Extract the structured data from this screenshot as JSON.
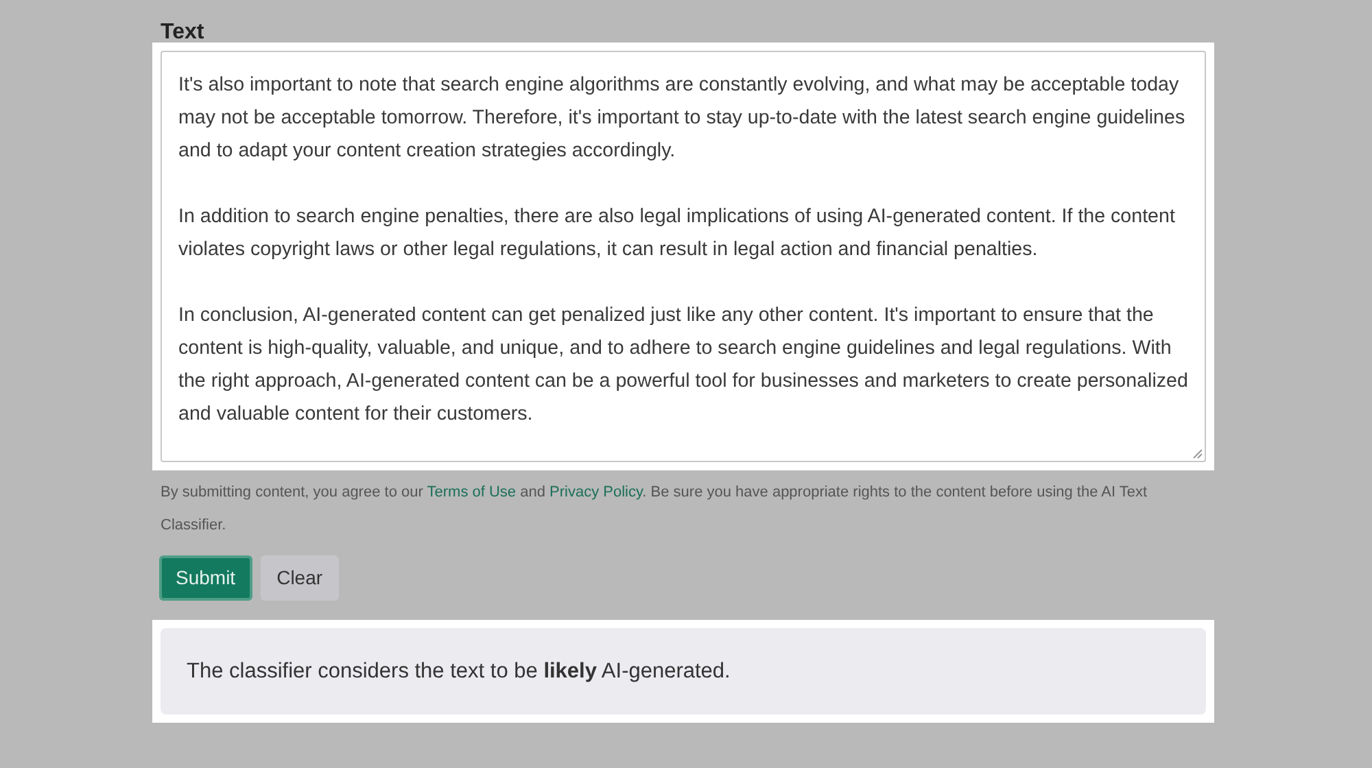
{
  "field_label": "Text",
  "text_input": {
    "paragraphs": [
      "It's also important to note that search engine algorithms are constantly evolving, and what may be acceptable today may not be acceptable tomorrow. Therefore, it's important to stay up-to-date with the latest search engine guidelines and to adapt your content creation strategies accordingly.",
      "In addition to search engine penalties, there are also legal implications of using AI-generated content. If the content violates copyright laws or other legal regulations, it can result in legal action and financial penalties.",
      "In conclusion, AI-generated content can get penalized just like any other content. It's important to ensure that the content is high-quality, valuable, and unique, and to adhere to search engine guidelines and legal regulations. With the right approach, AI-generated content can be a powerful tool for businesses and marketers to create personalized and valuable content for their customers."
    ]
  },
  "disclaimer": [
    {
      "kind": "text",
      "text": "By submitting content, you agree to our "
    },
    {
      "kind": "link",
      "text": "Terms of Use"
    },
    {
      "kind": "text",
      "text": " and "
    },
    {
      "kind": "link",
      "text": "Privacy Policy"
    },
    {
      "kind": "text",
      "text": ". Be sure you have appropriate rights to the content before using the AI Text Classifier."
    }
  ],
  "buttons": [
    {
      "kind": "primary",
      "label": "Submit"
    },
    {
      "kind": "secondary",
      "label": "Clear"
    }
  ],
  "result": "The classifier considers the text to be **likely** AI-generated."
}
